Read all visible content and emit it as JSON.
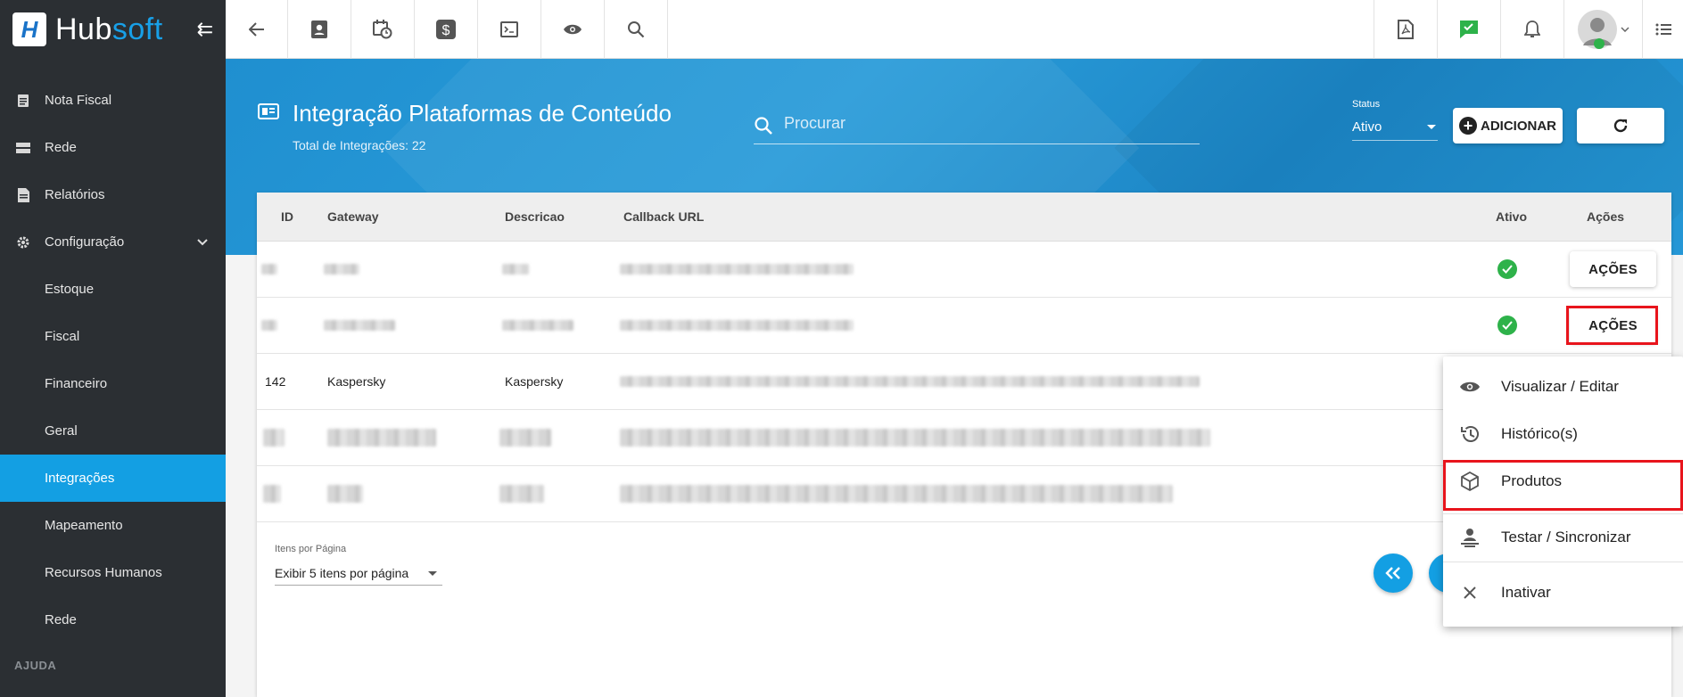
{
  "app": {
    "brand_a": "Hub",
    "brand_b": "soft"
  },
  "sidebar": {
    "items": [
      {
        "label": "Nota Fiscal",
        "icon": "document-icon"
      },
      {
        "label": "Rede",
        "icon": "server-icon"
      },
      {
        "label": "Relatórios",
        "icon": "report-icon"
      },
      {
        "label": "Configuração",
        "icon": "gear-icon"
      }
    ],
    "sub_items": [
      {
        "label": "Estoque"
      },
      {
        "label": "Fiscal"
      },
      {
        "label": "Financeiro"
      },
      {
        "label": "Geral"
      },
      {
        "label": "Integrações",
        "active": true
      },
      {
        "label": "Mapeamento"
      },
      {
        "label": "Recursos Humanos"
      },
      {
        "label": "Rede"
      }
    ],
    "section": "AJUDA"
  },
  "header": {
    "title": "Integração Plataformas de Conteúdo",
    "subtitle": "Total de Integrações: 22"
  },
  "search": {
    "placeholder": "Procurar"
  },
  "status_filter": {
    "label": "Status",
    "value": "Ativo"
  },
  "add_button": {
    "label": "ADICIONAR"
  },
  "table": {
    "columns": [
      "ID",
      "Gateway",
      "Descricao",
      "Callback URL",
      "Ativo",
      "Ações"
    ],
    "rows": [
      {
        "id": "",
        "gateway": "",
        "descricao": "",
        "callback_url": "",
        "ativo": true,
        "action": "AÇÕES"
      },
      {
        "id": "",
        "gateway": "",
        "descricao": "",
        "callback_url": "",
        "ativo": true,
        "action": "AÇÕES"
      },
      {
        "id": "142",
        "gateway": "Kaspersky",
        "descricao": "Kaspersky",
        "callback_url": "",
        "ativo": null,
        "action": ""
      },
      {
        "id": "",
        "gateway": "",
        "descricao": "",
        "callback_url": "",
        "ativo": null,
        "action": ""
      },
      {
        "id": "",
        "gateway": "",
        "descricao": "",
        "callback_url": "",
        "ativo": null,
        "action": ""
      }
    ]
  },
  "pagination": {
    "label": "Itens por Página",
    "value": "Exibir 5 itens por página"
  },
  "action_menu": {
    "items": [
      {
        "label": "Visualizar / Editar",
        "icon": "eye-icon"
      },
      {
        "label": "Histórico(s)",
        "icon": "history-icon"
      },
      {
        "label": "Produtos",
        "icon": "box-icon"
      },
      {
        "label": "Testar / Sincronizar",
        "icon": "sync-person-icon"
      },
      {
        "label": "Inativar",
        "icon": "close-icon"
      }
    ]
  },
  "colors": {
    "accent": "#139fe3",
    "hero": "#2196d3",
    "sidebar": "#2b2f33",
    "success": "#2eb24a",
    "highlight": "#e8141c"
  }
}
